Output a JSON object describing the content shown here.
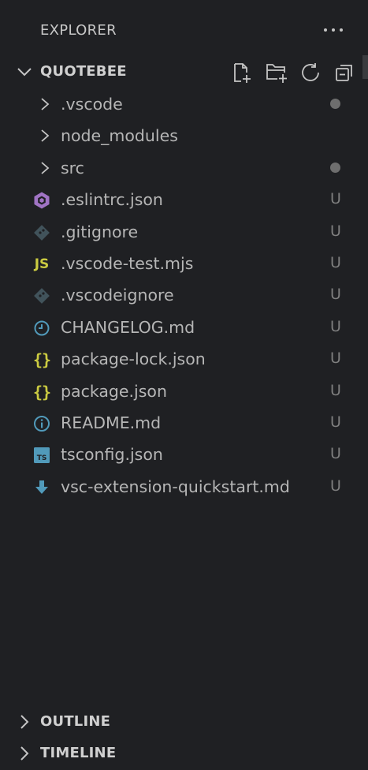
{
  "header": {
    "title": "EXPLORER",
    "more_icon": "ellipsis-icon"
  },
  "project": {
    "title": "QUOTEBEE",
    "expanded": true,
    "actions": [
      {
        "name": "new-file-button",
        "icon": "new-file-icon"
      },
      {
        "name": "new-folder-button",
        "icon": "new-folder-icon"
      },
      {
        "name": "refresh-button",
        "icon": "refresh-icon"
      },
      {
        "name": "collapse-all-button",
        "icon": "collapse-all-icon"
      }
    ]
  },
  "tree": [
    {
      "label": ".vscode",
      "kind": "folder",
      "status": "dot"
    },
    {
      "label": "node_modules",
      "kind": "folder",
      "status": ""
    },
    {
      "label": "src",
      "kind": "folder",
      "status": "dot"
    },
    {
      "label": ".eslintrc.json",
      "kind": "file",
      "icon": "eslint-icon",
      "status": "U"
    },
    {
      "label": ".gitignore",
      "kind": "file",
      "icon": "git-icon",
      "status": "U"
    },
    {
      "label": ".vscode-test.mjs",
      "kind": "file",
      "icon": "js-icon",
      "status": "U"
    },
    {
      "label": ".vscodeignore",
      "kind": "file",
      "icon": "git-icon",
      "status": "U"
    },
    {
      "label": "CHANGELOG.md",
      "kind": "file",
      "icon": "clock-icon",
      "status": "U"
    },
    {
      "label": "package-lock.json",
      "kind": "file",
      "icon": "json-icon",
      "status": "U"
    },
    {
      "label": "package.json",
      "kind": "file",
      "icon": "json-icon",
      "status": "U"
    },
    {
      "label": "README.md",
      "kind": "file",
      "icon": "info-icon",
      "status": "U"
    },
    {
      "label": "tsconfig.json",
      "kind": "file",
      "icon": "typescript-icon",
      "status": "U"
    },
    {
      "label": "vsc-extension-quickstart.md",
      "kind": "file",
      "icon": "download-icon",
      "status": "U"
    }
  ],
  "icons": {
    "js_text": "JS",
    "json_text": "{}",
    "ts_text": "TS"
  },
  "outline": {
    "title": "OUTLINE"
  },
  "timeline": {
    "title": "TIMELINE"
  },
  "colors": {
    "background": "#1f2023",
    "text": "#b6b6b6",
    "badge": "#7f7f7f",
    "eslint": "#a074c4",
    "git": "#41535b",
    "js": "#cbcb41",
    "clock": "#519aba",
    "json": "#cbcb41",
    "info": "#519aba",
    "typescript": "#519aba",
    "download": "#519aba"
  }
}
